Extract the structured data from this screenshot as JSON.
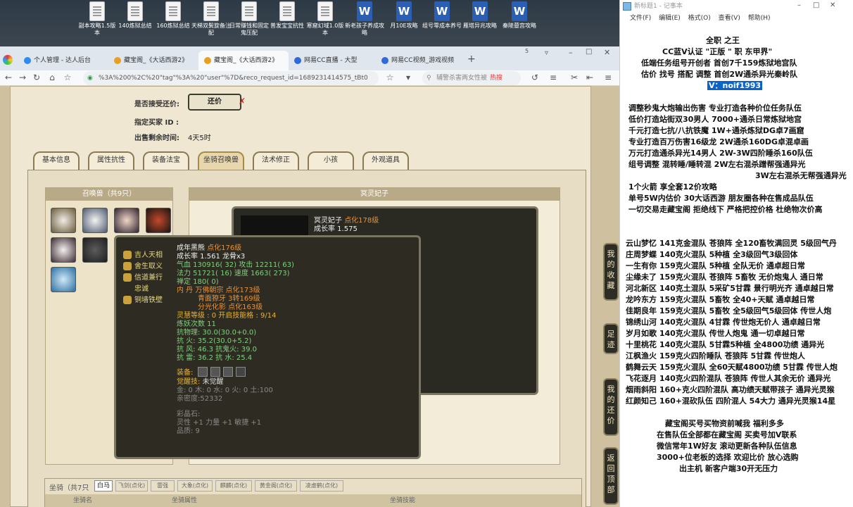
{
  "desktop_icons": [
    {
      "label": "副本攻略1.5版本",
      "type": "doc"
    },
    {
      "label": "140炼狱总结",
      "type": "doc"
    },
    {
      "label": "160炼狱总结",
      "type": "doc"
    },
    {
      "label": "天梯双鬓旋备注配",
      "type": "doc"
    },
    {
      "label": "日常赚钱和固定鬼压配",
      "type": "doc"
    },
    {
      "label": "普发宝宝抗性",
      "type": "doc"
    },
    {
      "label": "寒窟幻域1.0版本",
      "type": "doc"
    },
    {
      "label": "新老孩子养成攻略",
      "type": "word"
    },
    {
      "label": "月10E攻略",
      "type": "word"
    },
    {
      "label": "组号零成本养号",
      "type": "word"
    },
    {
      "label": "雁塔异兆攻略",
      "type": "word"
    },
    {
      "label": "秦陵墓宫攻略",
      "type": "word"
    }
  ],
  "browser": {
    "tabs": [
      "个人管理 - 达人后台",
      "藏宝阁_《大话西游2》",
      "藏宝阁_《大话西游2》",
      "网易CC直播 - 大型",
      "网易CC视频_游戏视频"
    ],
    "tab_count_badge": "5",
    "url": "%3A%200%2C%20\"tag\"%3A%20\"user\"%7D&reco_request_id=1689231414575_tBt0",
    "search_placeholder": "辅警杀害两女性被",
    "hot_label": "热搜"
  },
  "listing": {
    "accept_counter_label": "是否接受还价:",
    "counter_button": "还价",
    "buyer_label": "指定买家 ID :",
    "time_left_label": "出售剩余时间:",
    "time_left_value": "4天5时"
  },
  "game_tabs": [
    "基本信息",
    "属性抗性",
    "装备法宝",
    "坐骑召唤兽",
    "法术修正",
    "小孩",
    "外观道具"
  ],
  "summon": {
    "header": "召唤兽（共9只）",
    "detail_header": "冥灵妃子",
    "detail_name": "冥灵妃子",
    "detail_tag": "点化178级",
    "detail_growth": "成长率 1.575"
  },
  "tooltip": {
    "skills": [
      "吉人天相",
      "舍生取义",
      "信道兼行",
      "忠诚",
      "铜墙铁壁"
    ],
    "name": "成年黑熊",
    "name_tag": "点化176级",
    "line1": "成长率 1.561 龙骨x3",
    "line2": "气血 130916( 32) 攻击 12211( 63)",
    "line3": "法力 51721( 16) 速度 1663( 273)",
    "line4": "禅定 180( 0)",
    "line5": "内 丹 万佛朝宗 点化173级",
    "line6": "青面獠牙 3转169级",
    "line7": "分光化影 点化163级",
    "line8": "灵慧等级 : 0 开启技能格 : 9/14",
    "line9": "炼妖次数 11",
    "line10": "抗物理: 30.0(30.0+0.0)",
    "line11": "抗 火: 35.2(30.0+5.2)",
    "line12": "抗 风: 46.3 抗鬼火: 39.0",
    "line13": "抗 雷: 36.2 抗 水: 25.4",
    "equip_label": "装备:",
    "awake_label": "觉醒技:",
    "awake_value": "未觉醒",
    "elements": "金: 0 木: 0 水: 0 火: 0 土:100",
    "intimacy": "亲密度:52332",
    "gem_label": "彩晶石:",
    "gem_value": "灵性 +1 力量 +1 敏捷 +1",
    "quality": "品质: 9"
  },
  "side_buttons": [
    "我的收藏",
    "足迹",
    "我的还价",
    "返回顶部"
  ],
  "bottom": {
    "mount_label": "坐骑（共7只",
    "tabs": [
      "白马",
      "飞剑(点化)",
      "雷强",
      "大象(点化)",
      "麒麟(点化)",
      "黄金阁(点化)",
      "凌虚鹤(点化)"
    ],
    "cols": [
      "坐骑名",
      "坐骑属性",
      "坐骑技能"
    ]
  },
  "notepad": {
    "title": "新标题1 - 记事本",
    "menu": [
      "文件(F)",
      "编辑(E)",
      "格式(O)",
      "查看(V)",
      "帮助(H)"
    ],
    "header_lines": [
      "全职 之王",
      "CC蓝V认证 \"正版 \" 职 东甲界\"",
      "低端任务组号开创者 首创7千159炼狱地宫队",
      "估价 找号 搭配 调整 首创2W通杀异光秦岭队"
    ],
    "contact": "V：noif1993",
    "service_lines": [
      "调整秒鬼大炮输出伤害 专业打造各种价位任务队伍",
      "低价打造站街双30男人 7000+通杀日常炼狱地宫",
      "千元打造七抗/八抗铁魔 1W+通杀炼狱DG卓7画窟",
      "专业打造百万伤害16级龙 2W通杀160DG卓混卓画",
      "万元打造通杀异光14男人 2W-3W四阶睡杀160队伍",
      "组号调整 混转睡/睡转混 2W左右混杀蹭帮强通异光",
      "3W左右混杀无帮强通异光"
    ],
    "promo_lines": [
      "1个火箭 享全套12价攻略",
      "单号5W内估价 30大话西游 朋友圈各种在售成品队伍",
      "一切交易走藏宝阁 拒绝线下 严格把控价格 杜绝物次价高"
    ],
    "listing_lines": [
      "云山梦忆 141克金混队 苍狼阵 全120畜牧满回灵 5级回气丹",
      "庄周梦蝶 140克火混队 5种植 全3级回气3级回体",
      "一生有你 159克火混队 5种植 全队无价 通卓超日常",
      "尘缘未了 159克火混队 苍狼阵 5畜牧 无价炮鬼人 通日常",
      "河北新区 140克土混队 5采矿5甘霖 景行明光齐 通卓越日常",
      "龙吟东方 159克火混队 5畜牧 全40+天赋 通卓越日常",
      "佳期良年 159克火混队 5畜牧 全5级回气5级回体 传世人炮",
      "锦绣山河 140克火混队 4甘霖 传世炮无价人 通卓越日常",
      "岁月如歌 140克火混队 传世人炮鬼 通一切卓越日常",
      "十里桃花 140克火混队 5甘霖5种植 全4800功绩 通异光",
      "江枫渔火 159克火四阶睡队 苍狼阵 5甘霖 传世炮人",
      "鹤舞云天 159克火混队 全60天赋4800功绩 5甘霖 传世人炮",
      "飞花逐月 140克火四阶混队 苍狼阵 传世人其余无价 通异光",
      "烟雨斜阳 160+克火四阶混队 高功绩天赋带孩子 通异光灵猴",
      "红颜知己 160+混砍队伍 四阶混人 54大力 通异光灵猴14星"
    ],
    "footer_lines": [
      "藏宝阁买号买物资前喊我 福利多多",
      "在售队伍全部都在藏宝阁 买卖号加V联系",
      "微信常年1W好友 滚动更新各种队伍信息",
      "3000+位老板的选择 欢迎比价 放心选购",
      "出主机 新客户端30开无压力"
    ]
  }
}
